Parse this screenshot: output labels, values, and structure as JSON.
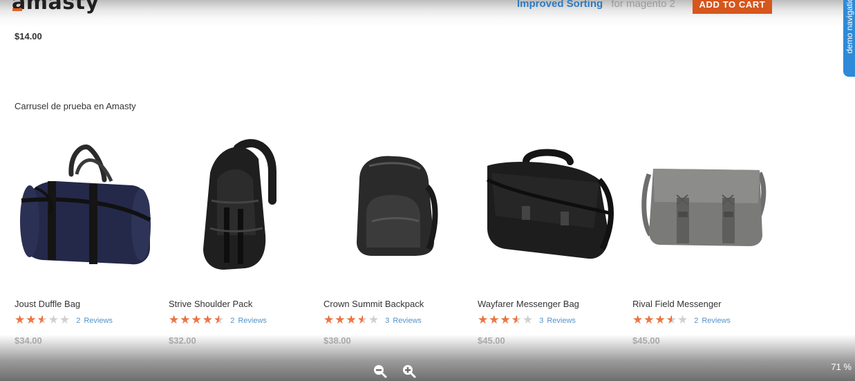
{
  "header": {
    "logo_text": "amasty",
    "promo_strong": "Improved Sorting",
    "promo_light": "for magento 2",
    "add_to_cart_label": "ADD TO CART"
  },
  "side_tab": {
    "label": "demo navigation"
  },
  "previous_product": {
    "price": "$14.00"
  },
  "carousel": {
    "title": "Carrusel de prueba en Amasty",
    "products": [
      {
        "name": "Joust Duffle Bag",
        "rating_fraction": 0.5,
        "review_count": "2",
        "reviews_label": "Reviews",
        "price": "$34.00",
        "icon": "duffle-bag"
      },
      {
        "name": "Strive Shoulder Pack",
        "rating_fraction": 0.9,
        "review_count": "2",
        "reviews_label": "Reviews",
        "price": "$32.00",
        "icon": "shoulder-pack"
      },
      {
        "name": "Crown Summit Backpack",
        "rating_fraction": 0.7,
        "review_count": "3",
        "reviews_label": "Reviews",
        "price": "$38.00",
        "icon": "backpack"
      },
      {
        "name": "Wayfarer Messenger Bag",
        "rating_fraction": 0.7,
        "review_count": "3",
        "reviews_label": "Reviews",
        "price": "$45.00",
        "icon": "messenger-bag"
      },
      {
        "name": "Rival Field Messenger",
        "rating_fraction": 0.7,
        "review_count": "2",
        "reviews_label": "Reviews",
        "price": "$45.00",
        "icon": "field-messenger"
      }
    ]
  },
  "controls": {
    "zoom_out_icon": "zoom-out-icon",
    "zoom_in_icon": "zoom-in-icon",
    "zoom_level": "71 %"
  },
  "colors": {
    "accent": "#d6561d",
    "star": "#ed5a1c",
    "link": "#2f7bbf",
    "tab": "#2e8ad8"
  }
}
